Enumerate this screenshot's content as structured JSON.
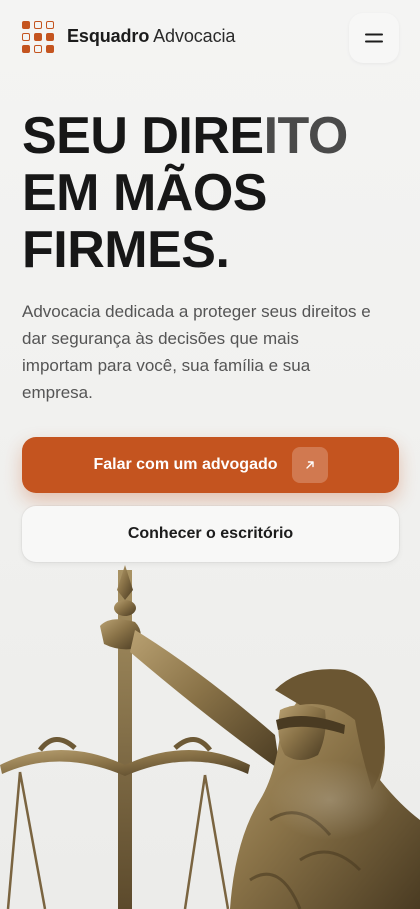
{
  "header": {
    "brand_bold": "Esquadro",
    "brand_light": "Advocacia",
    "menu_icon": "hamburger-icon"
  },
  "hero": {
    "title_line1_a": "SEU DIRE",
    "title_line1_b": "ITO",
    "title_line2": "EM MÃOS",
    "title_line3": "FIRMES.",
    "description": "Advocacia dedicada a proteger seus direitos e dar segurança às decisões que mais importam para você, sua família e sua empresa."
  },
  "actions": {
    "primary_label": "Falar com um advogado",
    "primary_icon": "arrow-up-right-icon",
    "secondary_label": "Conhecer o escritório"
  },
  "colors": {
    "accent": "#c4541f",
    "text_dark": "#171717",
    "background": "#f2f2f1"
  }
}
